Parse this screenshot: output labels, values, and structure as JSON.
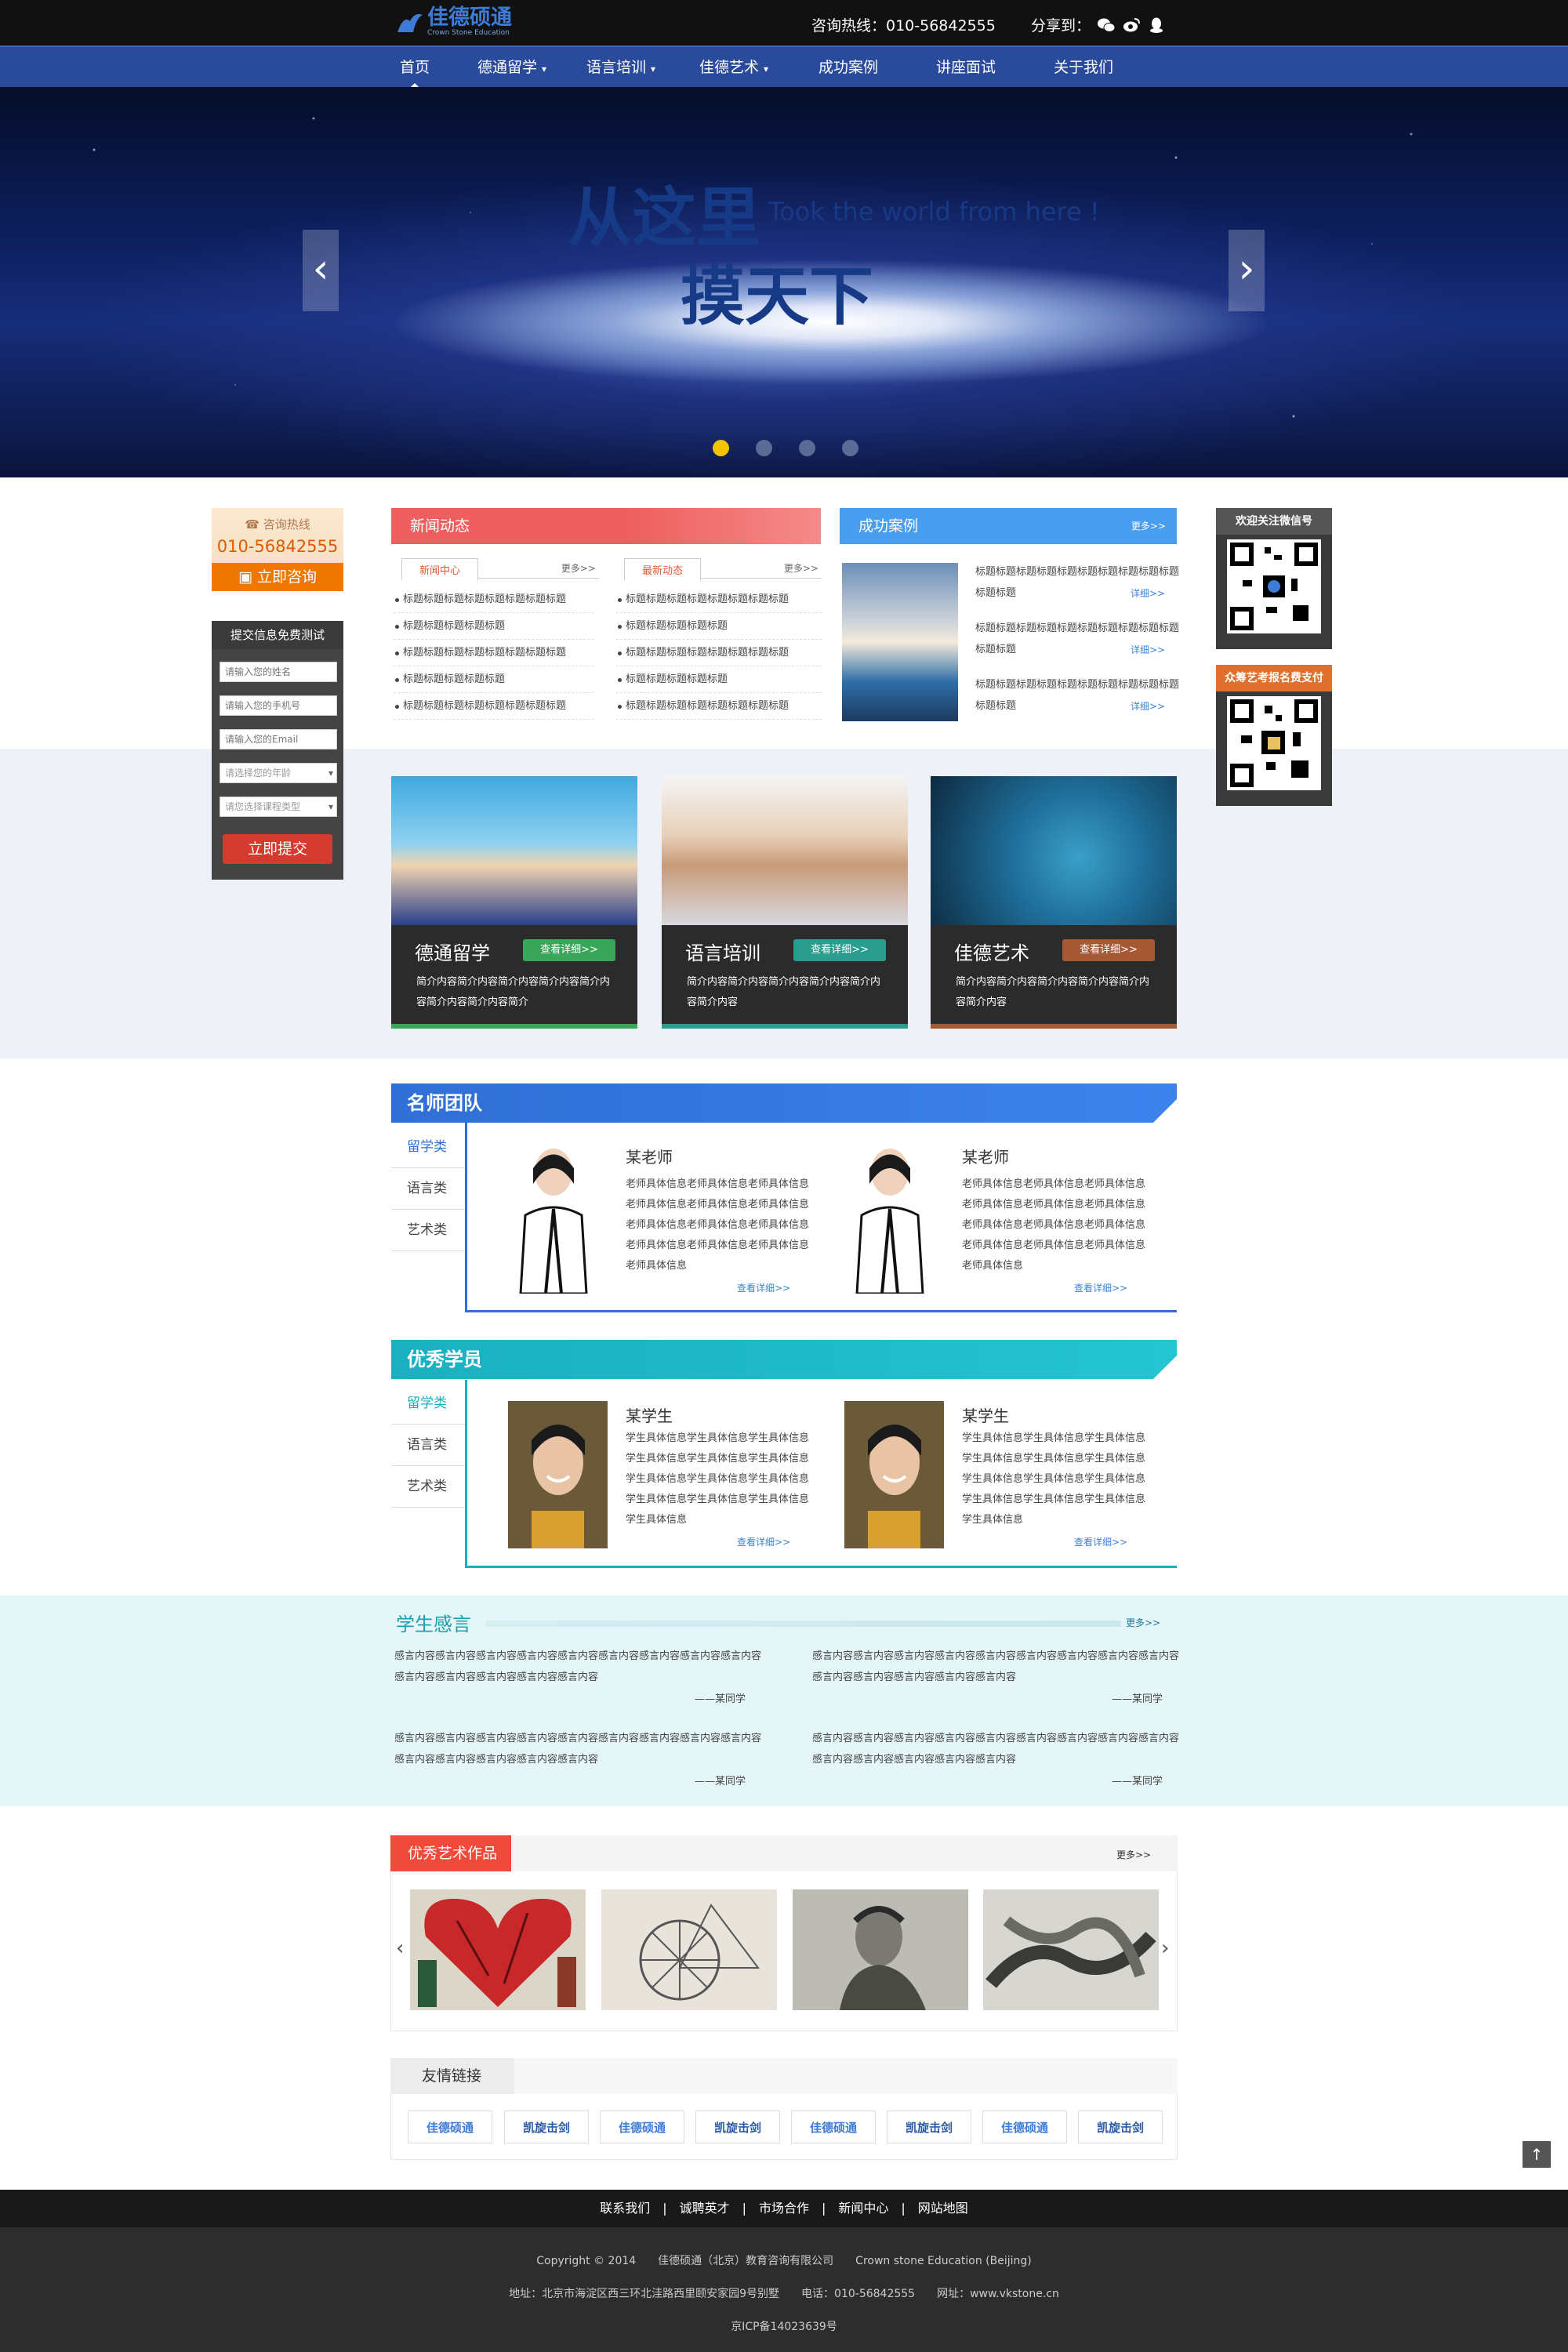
{
  "header": {
    "logo_cn": "佳德硕通",
    "logo_en": "Crown Stone Education",
    "hotline": "咨询热线：010-56842555",
    "share_label": "分享到：",
    "share_icons": [
      "wechat-icon",
      "weibo-icon",
      "qq-icon"
    ]
  },
  "nav": [
    "首页",
    "德通留学",
    "语言培训",
    "佳德艺术",
    "成功案例",
    "讲座面试",
    "关于我们"
  ],
  "banner": {
    "line1": "从这里",
    "line2": "Took the world from here !",
    "line3": "摸天下",
    "prev": "‹",
    "next": "›"
  },
  "sidebar": {
    "hotline_label": "☎ 咨询热线",
    "hotline_number": "010-56842555",
    "consult_btn": "立即咨询",
    "form_title": "提交信息免费测试",
    "ph_name": "请输入您的姓名",
    "ph_phone": "请输入您的手机号",
    "ph_email": "请输入您的Email",
    "sel_age": "请选择您的年龄",
    "sel_course": "请您选择课程类型",
    "submit": "立即提交"
  },
  "news": {
    "title": "新闻动态",
    "tab1": "新闻中心",
    "tab2": "最新动态",
    "more": "更多>>",
    "col1": [
      "标题标题标题标题标题标题标题标题",
      "标题标题标题标题标题",
      "标题标题标题标题标题标题标题标题",
      "标题标题标题标题标题",
      "标题标题标题标题标题标题标题标题"
    ],
    "col2": [
      "标题标题标题标题标题标题标题标题",
      "标题标题标题标题标题",
      "标题标题标题标题标题标题标题标题",
      "标题标题标题标题标题",
      "标题标题标题标题标题标题标题标题"
    ]
  },
  "cases": {
    "title": "成功案例",
    "more": "更多>>",
    "detail": "详细>>",
    "items": [
      "标题标题标题标题标题标题标题标题标题标题标题标题",
      "标题标题标题标题标题标题标题标题标题标题标题标题",
      "标题标题标题标题标题标题标题标题标题标题标题标题"
    ]
  },
  "qr": {
    "wechat": "欢迎关注微信号",
    "pay": "众筹艺考报名费支付"
  },
  "cards": [
    {
      "title": "德通留学",
      "btn": "查看详细>>",
      "desc": "简介内容简介内容简介内容简介内容简介内容简介内容简介内容简介",
      "btn_color": "#3aa65a",
      "bar_color": "#3aa65a"
    },
    {
      "title": "语言培训",
      "btn": "查看详细>>",
      "desc": "简介内容简介内容简介内容简介内容简介内容简介内容",
      "btn_color": "#2a9d8f",
      "bar_color": "#2a9d8f"
    },
    {
      "title": "佳德艺术",
      "btn": "查看详细>>",
      "desc": "简介内容简介内容简介内容简介内容简介内容简介内容",
      "btn_color": "#a55a35",
      "bar_color": "#a55a35"
    }
  ],
  "teachers": {
    "title": "名师团队",
    "tabs": [
      "留学类",
      "语言类",
      "艺术类"
    ],
    "items": [
      {
        "name": "某老师",
        "desc": "老师具体信息老师具体信息老师具体信息老师具体信息老师具体信息老师具体信息老师具体信息老师具体信息老师具体信息老师具体信息老师具体信息老师具体信息老师具体信息",
        "more": "查看详细>>"
      },
      {
        "name": "某老师",
        "desc": "老师具体信息老师具体信息老师具体信息老师具体信息老师具体信息老师具体信息老师具体信息老师具体信息老师具体信息老师具体信息老师具体信息老师具体信息老师具体信息",
        "more": "查看详细>>"
      }
    ]
  },
  "students": {
    "title": "优秀学员",
    "tabs": [
      "留学类",
      "语言类",
      "艺术类"
    ],
    "items": [
      {
        "name": "某学生",
        "desc": "学生具体信息学生具体信息学生具体信息学生具体信息学生具体信息学生具体信息学生具体信息学生具体信息学生具体信息学生具体信息学生具体信息学生具体信息学生具体信息",
        "more": "查看详细>>"
      },
      {
        "name": "某学生",
        "desc": "学生具体信息学生具体信息学生具体信息学生具体信息学生具体信息学生具体信息学生具体信息学生具体信息学生具体信息学生具体信息学生具体信息学生具体信息学生具体信息",
        "more": "查看详细>>"
      }
    ]
  },
  "feedback": {
    "title": "学生感言",
    "more": "更多>>",
    "text": "感言内容感言内容感言内容感言内容感言内容感言内容感言内容感言内容感言内容感言内容感言内容感言内容感言内容感言内容",
    "author": "——某同学"
  },
  "art": {
    "title": "优秀艺术作品",
    "more": "更多>>",
    "prev": "‹",
    "next": "›"
  },
  "links": {
    "title": "友情链接",
    "items": [
      "佳德硕通",
      "凯旋击剑",
      "佳德硕通",
      "凯旋击剑",
      "佳德硕通",
      "凯旋击剑",
      "佳德硕通",
      "凯旋击剑"
    ]
  },
  "footer": {
    "nav": "联系我们　|　诚聘英才　|　市场合作　|　新闻中心　|　网站地图",
    "copyright": "Copyright © 2014　　佳德硕通（北京）教育咨询有限公司　　Crown stone Education (Beijing)",
    "address": "地址：北京市海淀区西三环北洼路西里颐安家园9号别墅　　电话：010-56842555　　网址：www.vkstone.cn",
    "icp": "京ICP备14023639号",
    "totop": "↑"
  }
}
